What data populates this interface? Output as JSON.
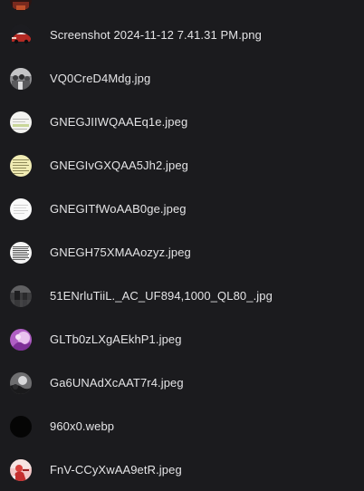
{
  "files": [
    {
      "name": "",
      "thumb": "red-dark-thumbnail-icon"
    },
    {
      "name": "Screenshot 2024-11-12 7.41.31 PM.png",
      "thumb": "car-red-thumbnail-icon"
    },
    {
      "name": "VQ0CreD4Mdg.jpg",
      "thumb": "grayscale-crowd-thumbnail-icon"
    },
    {
      "name": "GNEGJIIWQAAEq1e.jpeg",
      "thumb": "document-page-thumbnail-icon"
    },
    {
      "name": "GNEGIvGXQAA5Jh2.jpeg",
      "thumb": "yellow-text-thumbnail-icon"
    },
    {
      "name": "GNEGITfWoAAB0ge.jpeg",
      "thumb": "white-text-thumbnail-icon"
    },
    {
      "name": "GNEGH75XMAAozyz.jpeg",
      "thumb": "dense-text-thumbnail-icon"
    },
    {
      "name": "51ENrluTiiL._AC_UF894,1000_QL80_.jpg",
      "thumb": "dark-gray-thumbnail-icon"
    },
    {
      "name": "GLTb0zLXgAEkhP1.jpeg",
      "thumb": "purple-art-thumbnail-icon"
    },
    {
      "name": "Ga6UNAdXcAAT7r4.jpeg",
      "thumb": "bw-figure-thumbnail-icon"
    },
    {
      "name": "960x0.webp",
      "thumb": "black-thumbnail-icon"
    },
    {
      "name": "FnV-CCyXwAA9etR.jpeg",
      "thumb": "pink-figure-thumbnail-icon"
    }
  ]
}
